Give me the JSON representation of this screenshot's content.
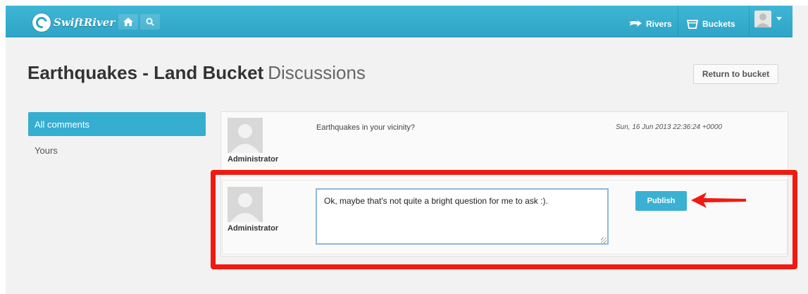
{
  "app": {
    "brand": "SwiftRiver",
    "colors": {
      "accent": "#35aecf",
      "annotation": "#f2190f"
    }
  },
  "nav": {
    "home_icon": "home-icon",
    "search_icon": "search-icon",
    "rivers_label": "Rivers",
    "buckets_label": "Buckets"
  },
  "header": {
    "title_strong": "Earthquakes - Land Bucket",
    "title_light": "Discussions",
    "return_label": "Return to bucket"
  },
  "sidebar": {
    "items": [
      {
        "label": "All comments",
        "active": true
      },
      {
        "label": "Yours",
        "active": false
      }
    ]
  },
  "discussion": {
    "comment": {
      "author": "Administrator",
      "text": "Earthquakes in your vicinity?",
      "date": "Sun, 16 Jun 2013 22:36:24 +0000"
    },
    "reply": {
      "author": "Administrator",
      "value": "Ok, maybe that's not quite a bright question for me to ask :).",
      "publish_label": "Publish"
    }
  }
}
